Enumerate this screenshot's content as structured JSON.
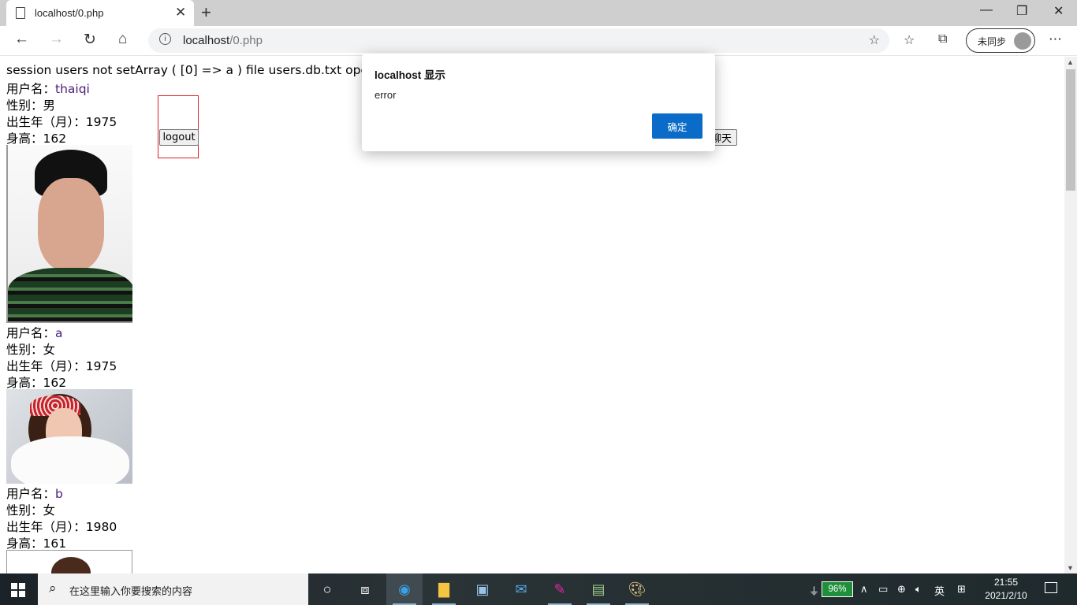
{
  "browser": {
    "tab_title": "localhost/0.php",
    "tab_close": "✕",
    "new_tab": "+",
    "url_host": "localhost",
    "url_path": "/0.php",
    "sync_label": "未同步",
    "window_minimize": "—",
    "window_restore": "❐",
    "window_close": "✕"
  },
  "page": {
    "debug_line": "session users not setArray ( [0] => a ) file users.db.txt open",
    "logout_label": "logout",
    "chat_label": "聊天",
    "users": [
      {
        "name_label": "用户名：",
        "name": "thaiqi",
        "gender_line": "性别：男",
        "birth_line": "出生年（月）：1975",
        "height_line": "身高：162"
      },
      {
        "name_label": "用户名：",
        "name": "a",
        "gender_line": "性别：女",
        "birth_line": "出生年（月）：1975",
        "height_line": "身高：162"
      },
      {
        "name_label": "用户名：",
        "name": "b",
        "gender_line": "性别：女",
        "birth_line": "出生年（月）：1980",
        "height_line": "身高：161"
      }
    ]
  },
  "dialog": {
    "title": "localhost 显示",
    "message": "error",
    "ok_label": "确定"
  },
  "taskbar": {
    "search_placeholder": "在这里输入你要搜索的内容",
    "battery": "96%",
    "ime": "英",
    "time": "21:55",
    "date": "2021/2/10"
  },
  "colors": {
    "accent": "#0b6bc9",
    "visited_link": "#4b1c76",
    "debug_box_border": "#dd2222"
  }
}
